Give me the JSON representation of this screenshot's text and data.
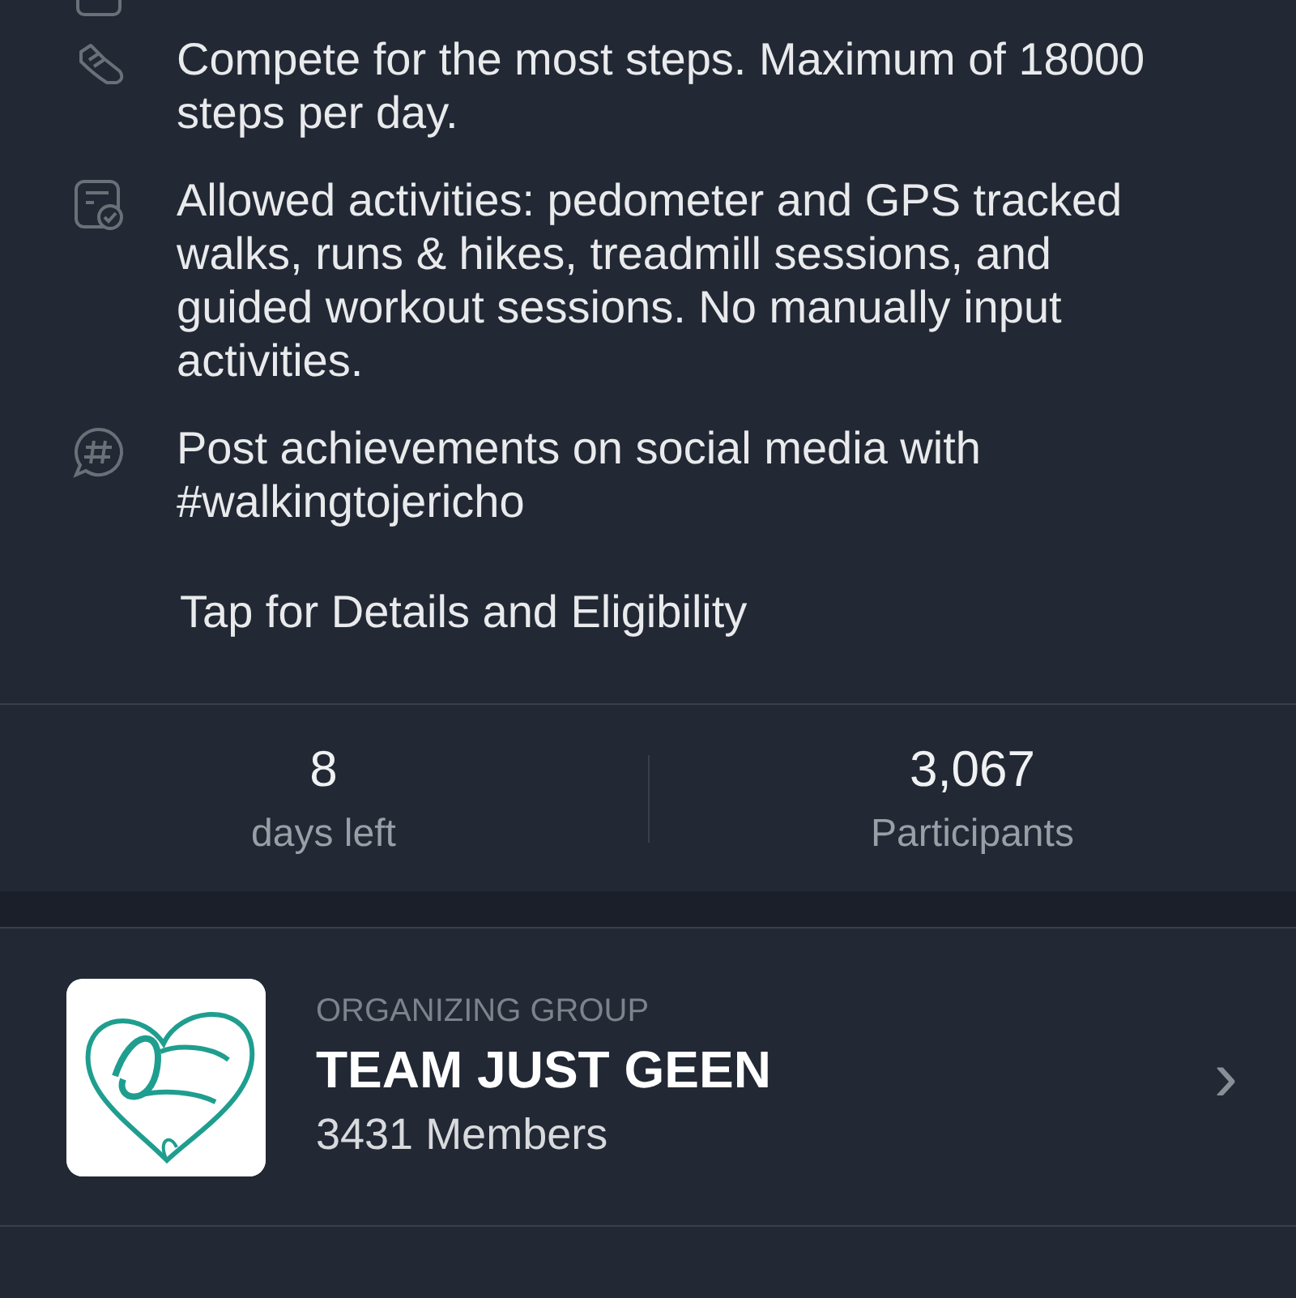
{
  "rules": [
    {
      "kind": "calendar"
    },
    {
      "kind": "shoe",
      "text": "Compete for the most steps. Maximum of 18000 steps per day."
    },
    {
      "kind": "checklist",
      "text": "Allowed activities: pedometer and GPS tracked walks, runs & hikes, treadmill sessions, and guided workout sessions. No manually input activities."
    },
    {
      "kind": "hashtag",
      "text": "Post achievements on social media with #walkingtojericho"
    }
  ],
  "details_link": "Tap for Details and Eligibility",
  "stats": [
    {
      "value": "8",
      "label": "days left"
    },
    {
      "value": "3,067",
      "label": "Participants"
    }
  ],
  "group": {
    "caption": "ORGANIZING GROUP",
    "name": "TEAM JUST GEEN",
    "members": "3431 Members",
    "chevron": "›"
  }
}
